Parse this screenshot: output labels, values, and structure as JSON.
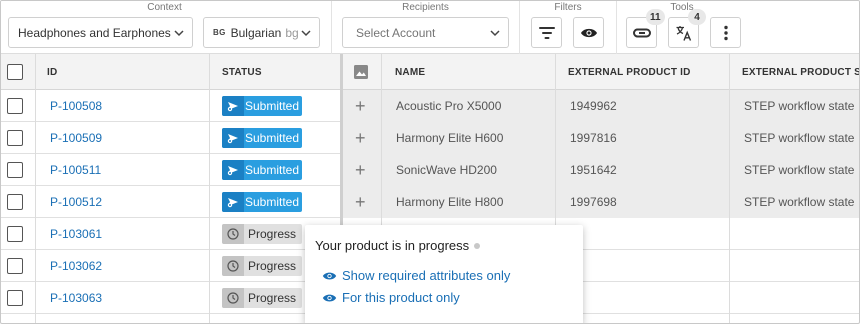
{
  "toolbar": {
    "context_label": "Context",
    "recipients_label": "Recipients",
    "filters_label": "Filters",
    "tools_label": "Tools",
    "category_value": "Headphones and Earphones",
    "language_flag": "BG",
    "language_value": "Bulgarian",
    "language_code": "bg",
    "account_placeholder": "Select Account",
    "links_badge": "11",
    "translate_badge": "4"
  },
  "table": {
    "columns": {
      "id": "ID",
      "status": "STATUS",
      "name": "NAME",
      "external_id": "EXTERNAL PRODUCT ID",
      "external_state": "EXTERNAL PRODUCT ST..."
    },
    "rows": [
      {
        "id": "P-100508",
        "status": "Submitted",
        "name": "Acoustic Pro X5000",
        "external_id": "1949962",
        "external_state": "STEP workflow state"
      },
      {
        "id": "P-100509",
        "status": "Submitted",
        "name": "Harmony Elite H600",
        "external_id": "1997816",
        "external_state": "STEP workflow state"
      },
      {
        "id": "P-100511",
        "status": "Submitted",
        "name": "SonicWave HD200",
        "external_id": "1951642",
        "external_state": "STEP workflow state"
      },
      {
        "id": "P-100512",
        "status": "Submitted",
        "name": "Harmony Elite H800",
        "external_id": "1997698",
        "external_state": "STEP workflow state"
      },
      {
        "id": "P-103061",
        "status": "Progress"
      },
      {
        "id": "P-103062",
        "status": "Progress"
      },
      {
        "id": "P-103063",
        "status": "Progress"
      }
    ],
    "add_symbol": "+"
  },
  "popover": {
    "title": "Your product is in progress",
    "link_required": "Show required attributes only",
    "link_product": "For this product only"
  },
  "colors": {
    "submitted": "#2a9ee0",
    "link": "#1a6fb5",
    "progress": "#e0e0e0"
  }
}
